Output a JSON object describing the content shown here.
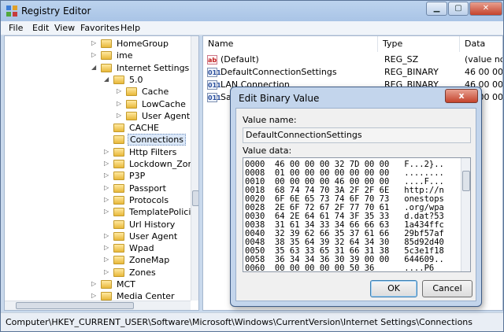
{
  "window": {
    "title": "Registry Editor"
  },
  "menu": [
    "File",
    "Edit",
    "View",
    "Favorites",
    "Help"
  ],
  "tree": [
    {
      "label": "HomeGroup",
      "indent": 0,
      "expander": "closed"
    },
    {
      "label": "ime",
      "indent": 0,
      "expander": "closed"
    },
    {
      "label": "Internet Settings",
      "indent": 0,
      "expander": "open"
    },
    {
      "label": "5.0",
      "indent": 1,
      "expander": "open"
    },
    {
      "label": "Cache",
      "indent": 2,
      "expander": "closed"
    },
    {
      "label": "LowCache",
      "indent": 2,
      "expander": "closed"
    },
    {
      "label": "User Agent",
      "indent": 2,
      "expander": "closed"
    },
    {
      "label": "CACHE",
      "indent": 1,
      "expander": "none"
    },
    {
      "label": "Connections",
      "indent": 1,
      "expander": "none",
      "selected": true
    },
    {
      "label": "Http Filters",
      "indent": 1,
      "expander": "closed"
    },
    {
      "label": "Lockdown_Zones",
      "indent": 1,
      "expander": "closed"
    },
    {
      "label": "P3P",
      "indent": 1,
      "expander": "closed"
    },
    {
      "label": "Passport",
      "indent": 1,
      "expander": "closed"
    },
    {
      "label": "Protocols",
      "indent": 1,
      "expander": "closed"
    },
    {
      "label": "TemplatePolicies",
      "indent": 1,
      "expander": "closed"
    },
    {
      "label": "Url History",
      "indent": 1,
      "expander": "none"
    },
    {
      "label": "User Agent",
      "indent": 1,
      "expander": "closed"
    },
    {
      "label": "Wpad",
      "indent": 1,
      "expander": "closed"
    },
    {
      "label": "ZoneMap",
      "indent": 1,
      "expander": "closed"
    },
    {
      "label": "Zones",
      "indent": 1,
      "expander": "closed"
    },
    {
      "label": "MCT",
      "indent": 0,
      "expander": "closed"
    },
    {
      "label": "Media Center",
      "indent": 0,
      "expander": "closed"
    }
  ],
  "list": {
    "columns": {
      "name": "Name",
      "type": "Type",
      "data": "Data"
    },
    "rows": [
      {
        "icon": "ab",
        "kind": "string",
        "name": "(Default)",
        "type": "REG_SZ",
        "data": "(value not"
      },
      {
        "icon": "011",
        "kind": "binary",
        "name": "DefaultConnectionSettings",
        "type": "REG_BINARY",
        "data": "46 00 00 0"
      },
      {
        "icon": "011",
        "kind": "binary",
        "name": "LAN Connection",
        "type": "REG_BINARY",
        "data": "46 00 00 0"
      },
      {
        "icon": "011",
        "kind": "binary",
        "name": "Sav",
        "type": "REG_BINARY",
        "data": "46 00 00 0"
      }
    ]
  },
  "status": {
    "path": "Computer\\HKEY_CURRENT_USER\\Software\\Microsoft\\Windows\\CurrentVersion\\Internet Settings\\Connections"
  },
  "dialog": {
    "title": "Edit Binary Value",
    "close": "x",
    "value_name_label": "Value name:",
    "value_name": "DefaultConnectionSettings",
    "value_data_label": "Value data:",
    "hex_lines": [
      "0000  46 00 00 00 32 7D 00 00   F...2}..",
      "0008  01 00 00 00 00 00 00 00   ........",
      "0010  00 00 00 00 46 00 00 00   ....F...",
      "0018  68 74 74 70 3A 2F 2F 6E   http://n",
      "0020  6F 6E 65 73 74 6F 70 73   onestops",
      "0028  2E 6F 72 67 2F 77 70 61   .org/wpa",
      "0030  64 2E 64 61 74 3F 35 33   d.dat?53",
      "0038  31 61 34 33 34 66 66 63   1a434ffc",
      "0040  32 39 62 66 35 37 61 66   29bf57af",
      "0048  38 35 64 39 32 64 34 30   85d92d40",
      "0050  35 63 33 65 31 66 31 38   5c3e1f18",
      "0058  36 34 34 36 30 39 00 00   644609..",
      "0060  00 00 00 00 00 50 36      ....P6"
    ],
    "ok": "OK",
    "cancel": "Cancel"
  }
}
